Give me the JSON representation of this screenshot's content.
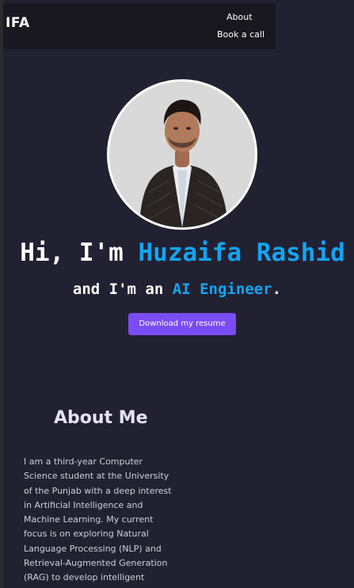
{
  "navbar": {
    "brand": "IFA",
    "links": [
      "About",
      "Book a call"
    ]
  },
  "hero": {
    "greeting": "Hi, I'm ",
    "name": "Huzaifa Rashid",
    "subtitle_prefix": "and I'm an ",
    "role": "AI Engineer",
    "subtitle_suffix": ".",
    "resume_button": "Download my resume"
  },
  "about": {
    "heading": "About Me",
    "lines": [
      "I am a third-year Computer",
      "Science student at the University",
      "of the Punjab with a deep interest",
      "in Artificial Intelligence and",
      "Machine Learning. My current",
      "focus is on exploring Natural",
      "Language Processing (NLP) and",
      "Retrieval-Augmented Generation",
      "(RAG) to develop intelligent"
    ]
  },
  "colors": {
    "background": "#222131",
    "navbar": "#191820",
    "accent": "#14a4f2",
    "button": "#7a4cf3"
  }
}
